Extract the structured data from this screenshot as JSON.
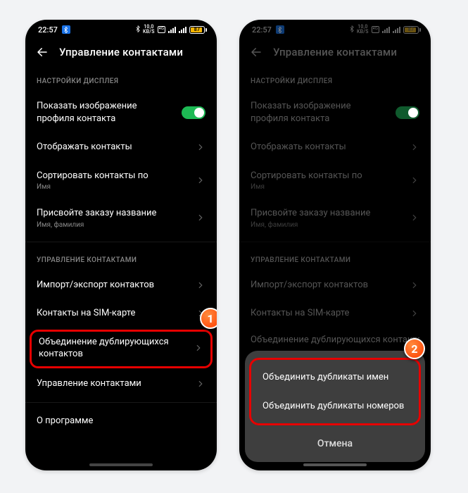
{
  "status": {
    "time": "22:57",
    "net_top": "10,0",
    "net_bottom": "KB/S",
    "battery": "87"
  },
  "header": {
    "title": "Управление контактами"
  },
  "sections": {
    "display": "НАСТРОЙКИ ДИСПЛЕЯ",
    "manage": "УПРАВЛЕНИЕ КОНТАКТАМИ"
  },
  "rows": {
    "show_profile_image": "Показать изображение профиля контакта",
    "show_contacts": "Отображать контакты",
    "sort_contacts": "Сортировать контакты по",
    "sort_contacts_sub": "Имя",
    "name_order": "Присвойте заказу название",
    "name_order_sub": "Имя, фамилия",
    "import_export": "Импорт/экспорт контактов",
    "sim_contacts": "Контакты на SIM-карте",
    "merge_duplicates": "Объединение дублирующихся контактов",
    "manage_contacts": "Управление контактами",
    "about": "О программе"
  },
  "sheet": {
    "merge_names": "Объединить дубликаты имен",
    "merge_numbers": "Объединить дубликаты номеров",
    "cancel": "Отмена"
  },
  "markers": {
    "one": "1",
    "two": "2"
  }
}
